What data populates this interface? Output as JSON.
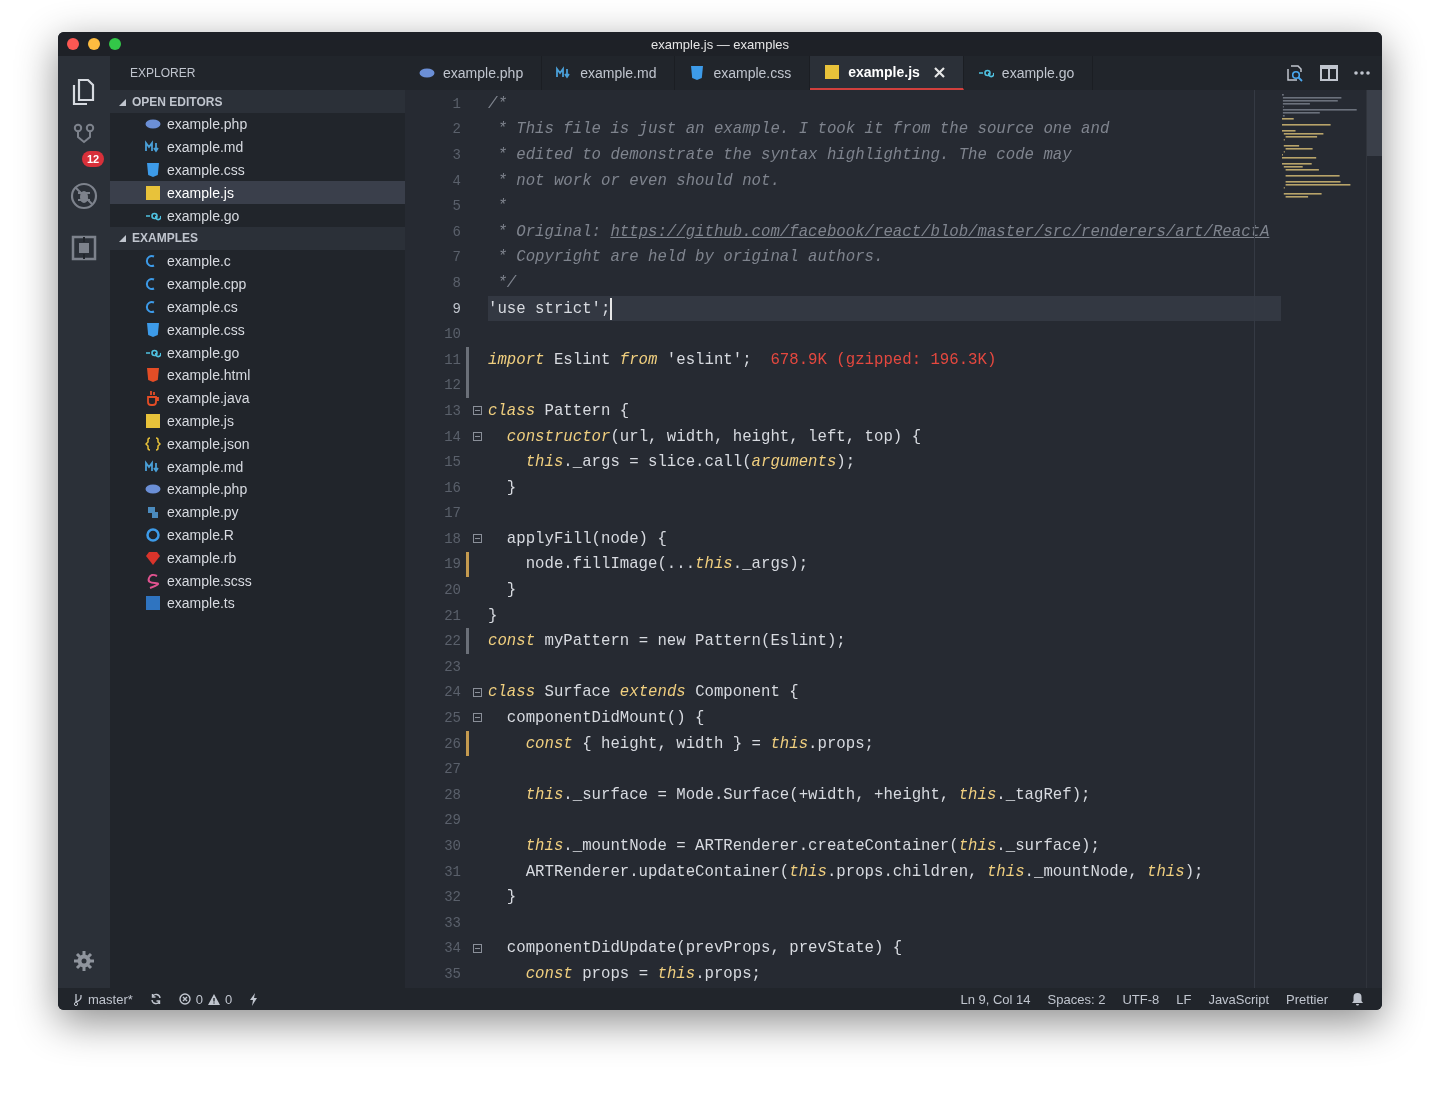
{
  "window": {
    "title": "example.js — examples"
  },
  "activity_bar": [
    {
      "kind": "files",
      "selected": true
    },
    {
      "kind": "source-control",
      "selected": false,
      "badge": "12"
    },
    {
      "kind": "debug",
      "selected": false
    },
    {
      "kind": "extensions",
      "selected": false
    }
  ],
  "sidebar": {
    "title": "EXPLORER",
    "sections": [
      {
        "title": "OPEN EDITORS",
        "expanded": true,
        "items": [
          {
            "name": "example.php",
            "kind": "php",
            "selected": false
          },
          {
            "name": "example.md",
            "kind": "md",
            "selected": false
          },
          {
            "name": "example.css",
            "kind": "css",
            "selected": false
          },
          {
            "name": "example.js",
            "kind": "js",
            "selected": true
          },
          {
            "name": "example.go",
            "kind": "go",
            "selected": false
          }
        ]
      },
      {
        "title": "EXAMPLES",
        "expanded": true,
        "items": [
          {
            "name": "example.c",
            "kind": "c",
            "selected": false
          },
          {
            "name": "example.cpp",
            "kind": "cpp",
            "selected": false
          },
          {
            "name": "example.cs",
            "kind": "cs",
            "selected": false
          },
          {
            "name": "example.css",
            "kind": "css",
            "selected": false
          },
          {
            "name": "example.go",
            "kind": "go",
            "selected": false
          },
          {
            "name": "example.html",
            "kind": "html",
            "selected": false
          },
          {
            "name": "example.java",
            "kind": "java",
            "selected": false
          },
          {
            "name": "example.js",
            "kind": "js",
            "selected": false
          },
          {
            "name": "example.json",
            "kind": "json",
            "selected": false
          },
          {
            "name": "example.md",
            "kind": "md",
            "selected": false
          },
          {
            "name": "example.php",
            "kind": "php",
            "selected": false
          },
          {
            "name": "example.py",
            "kind": "py",
            "selected": false
          },
          {
            "name": "example.R",
            "kind": "r",
            "selected": false
          },
          {
            "name": "example.rb",
            "kind": "rb",
            "selected": false
          },
          {
            "name": "example.scss",
            "kind": "scss",
            "selected": false
          },
          {
            "name": "example.ts",
            "kind": "ts",
            "selected": false
          }
        ]
      }
    ]
  },
  "tabs": [
    {
      "label": "example.php",
      "kind": "php",
      "selected": false
    },
    {
      "label": "example.md",
      "kind": "md",
      "selected": false
    },
    {
      "label": "example.css",
      "kind": "css",
      "selected": false
    },
    {
      "label": "example.js",
      "kind": "js",
      "selected": true
    },
    {
      "label": "example.go",
      "kind": "go",
      "selected": false
    }
  ],
  "editor": {
    "lines": [
      {
        "n": "1",
        "fold": false,
        "added": false,
        "modified": false,
        "segs": [
          {
            "kind": "comment",
            "text": "/*"
          }
        ]
      },
      {
        "n": "2",
        "fold": false,
        "added": false,
        "modified": false,
        "segs": [
          {
            "kind": "comment",
            "text": " * This file is just an example. I took it from the source one and"
          }
        ]
      },
      {
        "n": "3",
        "fold": false,
        "added": false,
        "modified": false,
        "segs": [
          {
            "kind": "comment",
            "text": " * edited to demonstrate the syntax highlighting. The code may"
          }
        ]
      },
      {
        "n": "4",
        "fold": false,
        "added": false,
        "modified": false,
        "segs": [
          {
            "kind": "comment",
            "text": " * not work or even should not."
          }
        ]
      },
      {
        "n": "5",
        "fold": false,
        "added": false,
        "modified": false,
        "segs": [
          {
            "kind": "comment",
            "text": " *"
          }
        ]
      },
      {
        "n": "6",
        "fold": false,
        "added": false,
        "modified": false,
        "segs": [
          {
            "kind": "comment",
            "text": " * Original: "
          },
          {
            "kind": "link",
            "text": "https://github.com/facebook/react/blob/master/src/renderers/art/ReactA"
          }
        ]
      },
      {
        "n": "7",
        "fold": false,
        "added": false,
        "modified": false,
        "segs": [
          {
            "kind": "comment",
            "text": " * Copyright are held by original authors."
          }
        ]
      },
      {
        "n": "8",
        "fold": false,
        "added": false,
        "modified": false,
        "segs": [
          {
            "kind": "comment",
            "text": " */"
          }
        ]
      },
      {
        "n": "9",
        "fold": false,
        "added": false,
        "modified": false,
        "current": true,
        "segs": [
          {
            "kind": "plain",
            "text": "'use strict';"
          }
        ]
      },
      {
        "n": "10",
        "fold": false,
        "added": false,
        "modified": false
      },
      {
        "n": "11",
        "fold": false,
        "added": true,
        "modified": false,
        "segs": [
          {
            "kind": "keyword",
            "text": "import"
          },
          {
            "kind": "plain",
            "text": " Eslint "
          },
          {
            "kind": "keyword",
            "text": "from"
          },
          {
            "kind": "plain",
            "text": " 'eslint';  "
          },
          {
            "kind": "size",
            "text": "678.9K (gzipped: 196.3K)"
          }
        ]
      },
      {
        "n": "12",
        "fold": false,
        "added": true,
        "modified": false
      },
      {
        "n": "13",
        "fold": true,
        "added": false,
        "modified": false,
        "segs": [
          {
            "kind": "keyword",
            "text": "class"
          },
          {
            "kind": "plain",
            "text": " Pattern {"
          }
        ]
      },
      {
        "n": "14",
        "fold": true,
        "added": false,
        "modified": false,
        "segs": [
          {
            "kind": "keyword",
            "text": "  constructor"
          },
          {
            "kind": "plain",
            "text": "(url, width, height, left, top) {"
          }
        ]
      },
      {
        "n": "15",
        "fold": false,
        "added": false,
        "modified": false,
        "segs": [
          {
            "kind": "keyword",
            "text": "    this"
          },
          {
            "kind": "plain",
            "text": "._args = slice.call("
          },
          {
            "kind": "keyword",
            "text": "arguments"
          },
          {
            "kind": "plain",
            "text": ");"
          }
        ]
      },
      {
        "n": "16",
        "fold": false,
        "added": false,
        "modified": false,
        "segs": [
          {
            "kind": "plain",
            "text": "  }"
          }
        ]
      },
      {
        "n": "17",
        "fold": false,
        "added": false,
        "modified": false
      },
      {
        "n": "18",
        "fold": true,
        "added": false,
        "modified": false,
        "segs": [
          {
            "kind": "plain",
            "text": "  applyFill(node) {"
          }
        ]
      },
      {
        "n": "19",
        "fold": false,
        "added": false,
        "modified": true,
        "segs": [
          {
            "kind": "plain",
            "text": "    node.fillImage(..."
          },
          {
            "kind": "keyword",
            "text": "this"
          },
          {
            "kind": "plain",
            "text": "._args);"
          }
        ]
      },
      {
        "n": "20",
        "fold": false,
        "added": false,
        "modified": false,
        "segs": [
          {
            "kind": "plain",
            "text": "  }"
          }
        ]
      },
      {
        "n": "21",
        "fold": false,
        "added": false,
        "modified": false,
        "segs": [
          {
            "kind": "plain",
            "text": "}"
          }
        ]
      },
      {
        "n": "22",
        "fold": false,
        "added": true,
        "modified": false,
        "segs": [
          {
            "kind": "keyword",
            "text": "const"
          },
          {
            "kind": "plain",
            "text": " myPattern = new Pattern(Eslint);"
          }
        ]
      },
      {
        "n": "23",
        "fold": false,
        "added": false,
        "modified": false
      },
      {
        "n": "24",
        "fold": true,
        "added": false,
        "modified": false,
        "segs": [
          {
            "kind": "keyword",
            "text": "class"
          },
          {
            "kind": "plain",
            "text": " Surface "
          },
          {
            "kind": "keyword",
            "text": "extends"
          },
          {
            "kind": "plain",
            "text": " Component {"
          }
        ]
      },
      {
        "n": "25",
        "fold": true,
        "added": false,
        "modified": false,
        "segs": [
          {
            "kind": "plain",
            "text": "  componentDidMount() {"
          }
        ]
      },
      {
        "n": "26",
        "fold": false,
        "added": false,
        "modified": true,
        "segs": [
          {
            "kind": "keyword",
            "text": "    const"
          },
          {
            "kind": "plain",
            "text": " { height, width } = "
          },
          {
            "kind": "keyword",
            "text": "this"
          },
          {
            "kind": "plain",
            "text": ".props;"
          }
        ]
      },
      {
        "n": "27",
        "fold": false,
        "added": false,
        "modified": false
      },
      {
        "n": "28",
        "fold": false,
        "added": false,
        "modified": false,
        "segs": [
          {
            "kind": "keyword",
            "text": "    this"
          },
          {
            "kind": "plain",
            "text": "._surface = Mode.Surface(+width, +height, "
          },
          {
            "kind": "keyword",
            "text": "this"
          },
          {
            "kind": "plain",
            "text": "._tagRef);"
          }
        ]
      },
      {
        "n": "29",
        "fold": false,
        "added": false,
        "modified": false
      },
      {
        "n": "30",
        "fold": false,
        "added": false,
        "modified": false,
        "segs": [
          {
            "kind": "keyword",
            "text": "    this"
          },
          {
            "kind": "plain",
            "text": "._mountNode = ARTRenderer.createContainer("
          },
          {
            "kind": "keyword",
            "text": "this"
          },
          {
            "kind": "plain",
            "text": "._surface);"
          }
        ]
      },
      {
        "n": "31",
        "fold": false,
        "added": false,
        "modified": false,
        "segs": [
          {
            "kind": "plain",
            "text": "    ARTRenderer.updateContainer("
          },
          {
            "kind": "keyword",
            "text": "this"
          },
          {
            "kind": "plain",
            "text": ".props.children, "
          },
          {
            "kind": "keyword",
            "text": "this"
          },
          {
            "kind": "plain",
            "text": "._mountNode, "
          },
          {
            "kind": "keyword",
            "text": "this"
          },
          {
            "kind": "plain",
            "text": ");"
          }
        ]
      },
      {
        "n": "32",
        "fold": false,
        "added": false,
        "modified": false,
        "segs": [
          {
            "kind": "plain",
            "text": "  }"
          }
        ]
      },
      {
        "n": "33",
        "fold": false,
        "added": false,
        "modified": false
      },
      {
        "n": "34",
        "fold": true,
        "added": false,
        "modified": false,
        "segs": [
          {
            "kind": "plain",
            "text": "  componentDidUpdate(prevProps, prevState) {"
          }
        ]
      },
      {
        "n": "35",
        "fold": false,
        "added": false,
        "modified": false,
        "segs": [
          {
            "kind": "keyword",
            "text": "    const"
          },
          {
            "kind": "plain",
            "text": " props = "
          },
          {
            "kind": "keyword",
            "text": "this"
          },
          {
            "kind": "plain",
            "text": ".props;"
          }
        ]
      }
    ]
  },
  "status_bar": {
    "branch": "master*",
    "errors": "0",
    "warnings": "0",
    "right": [
      "Ln 9, Col 14",
      "Spaces: 2",
      "UTF-8",
      "LF",
      "JavaScript",
      "Prettier"
    ]
  }
}
